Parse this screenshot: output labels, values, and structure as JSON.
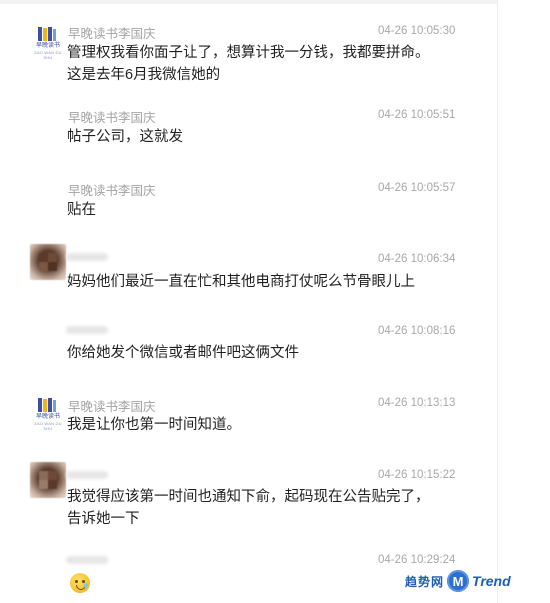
{
  "messages": [
    {
      "id": "m1",
      "avatar": "logo",
      "logo_caption": "早晚读书",
      "logo_subcaption": "ZAO WAN DU SHU",
      "sender": "早晚读书李国庆",
      "time": "04-26 10:05:30",
      "text": "管理权我看你面子让了，想算计我一分钱，我都要拼命。这是去年6月我微信她的"
    },
    {
      "id": "m2",
      "avatar": "none",
      "sender": "早晚读书李国庆",
      "time": "04-26 10:05:51",
      "text": "帖子公司，这就发"
    },
    {
      "id": "m3",
      "avatar": "none",
      "sender": "早晚读书李国庆",
      "time": "04-26 10:05:57",
      "text": "贴在"
    },
    {
      "id": "m4",
      "avatar": "photo",
      "sender": "",
      "time": "04-26 10:06:34",
      "text": "妈妈他们最近一直在忙和其他电商打仗呢么节骨眼儿上"
    },
    {
      "id": "m5",
      "avatar": "none",
      "sender": "",
      "time": "04-26 10:08:16",
      "text": "你给她发个微信或者邮件吧这俩文件"
    },
    {
      "id": "m6",
      "avatar": "logo",
      "logo_caption": "早晚读书",
      "logo_subcaption": "ZAO WAN DU SHU",
      "sender": "早晚读书李国庆",
      "time": "04-26 10:13:13",
      "text": "我是让你也第一时间知道。"
    },
    {
      "id": "m7",
      "avatar": "photo",
      "sender": "",
      "time": "04-26 10:15:22",
      "text": "我觉得应该第一时间也通知下俞，起码现在公告贴完了，告诉她一下"
    },
    {
      "id": "m8",
      "avatar": "none",
      "sender": "",
      "time": "04-26 10:29:24",
      "text": "",
      "emoji": "sweat-smile-emoji"
    }
  ],
  "watermark": {
    "cn": "趋势网",
    "letter": "M",
    "brand": "Trend"
  },
  "colors": {
    "sender": "#a3a3a3",
    "time": "#a8a8a8",
    "text": "#1f1f1f",
    "watermark": "#1f5fb3",
    "watermark_badge": "#2b6fd1"
  }
}
